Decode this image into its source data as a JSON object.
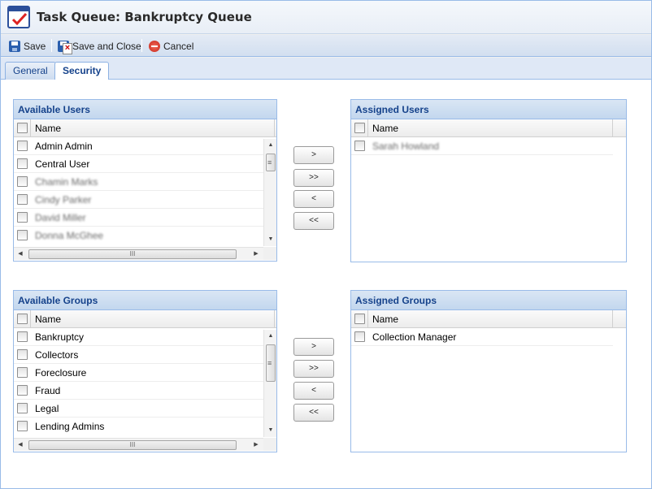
{
  "window": {
    "title": "Task Queue: Bankruptcy Queue"
  },
  "toolbar": {
    "save_label": "Save",
    "save_close_label": "Save and Close",
    "cancel_label": "Cancel"
  },
  "tabs": [
    {
      "label": "General",
      "active": false
    },
    {
      "label": "Security",
      "active": true
    }
  ],
  "available_users": {
    "title": "Available Users",
    "column": "Name",
    "rows": [
      "Admin Admin",
      "Central User",
      "Chamin Marks",
      "Cindy Parker",
      "David Miller",
      "Donna McGhee"
    ]
  },
  "assigned_users": {
    "title": "Assigned Users",
    "column": "Name",
    "rows": [
      "Sarah Howland"
    ]
  },
  "available_groups": {
    "title": "Available Groups",
    "column": "Name",
    "rows": [
      "Bankruptcy",
      "Collectors",
      "Foreclosure",
      "Fraud",
      "Legal",
      "Lending Admins"
    ]
  },
  "assigned_groups": {
    "title": "Assigned Groups",
    "column": "Name",
    "rows": [
      "Collection Manager"
    ]
  },
  "move_buttons": {
    "move_one": ">",
    "move_all": ">>",
    "remove_one": "<",
    "remove_all": "<<"
  },
  "icons": {
    "app": "checklist-icon",
    "save": "floppy-disk-icon",
    "save_close": "floppy-close-icon",
    "cancel": "cancel-icon"
  },
  "colors": {
    "panel_title": "#15428b",
    "border": "#99bbe8",
    "header_bg": "#c3d7ee"
  }
}
